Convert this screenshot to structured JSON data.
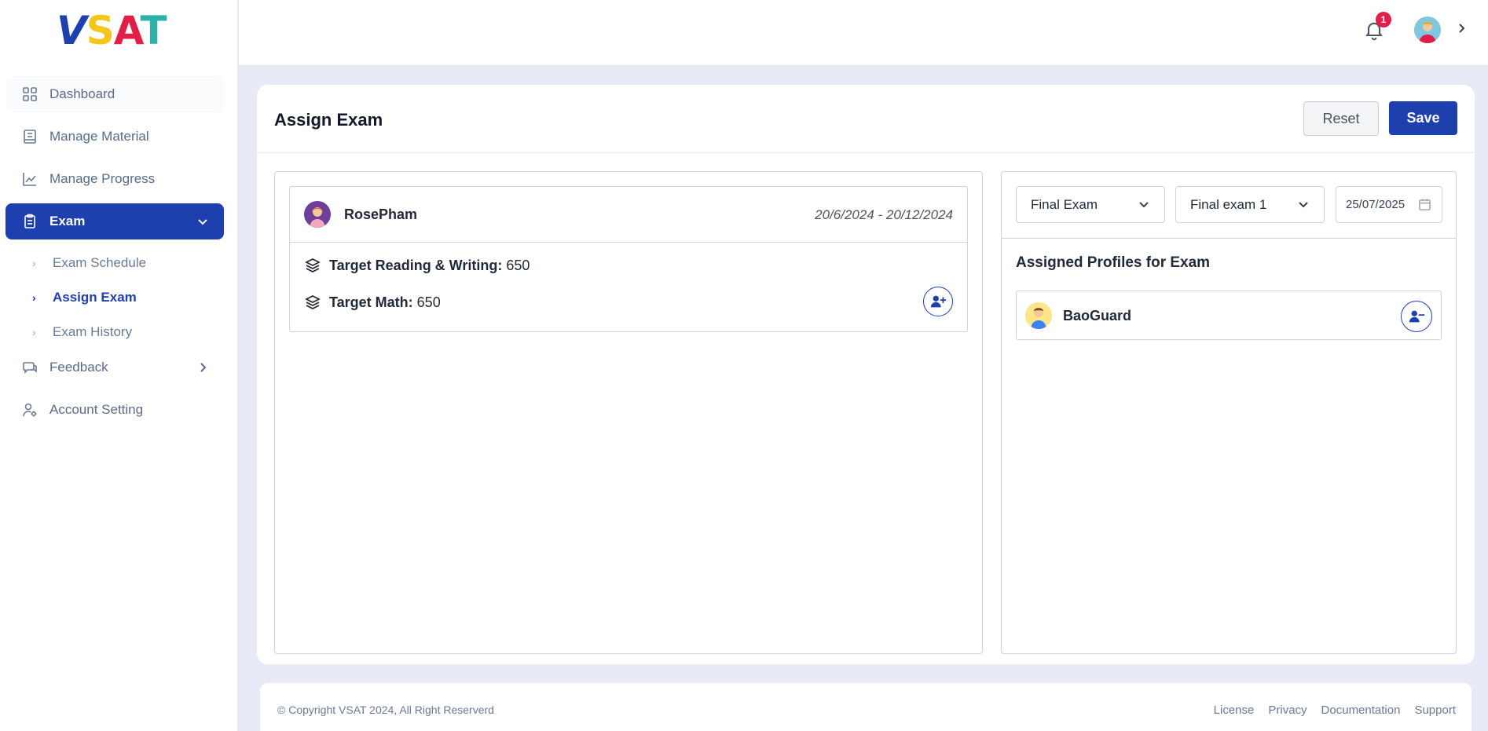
{
  "brand": {
    "letters": [
      "V",
      "S",
      "A",
      "T"
    ]
  },
  "sidebar": {
    "items": [
      {
        "label": "Dashboard",
        "icon": "grid-icon"
      },
      {
        "label": "Manage Material",
        "icon": "book-icon"
      },
      {
        "label": "Manage Progress",
        "icon": "chart-line-icon"
      },
      {
        "label": "Exam",
        "icon": "clipboard-icon",
        "active": true,
        "children": [
          {
            "label": "Exam Schedule"
          },
          {
            "label": "Assign Exam",
            "active": true
          },
          {
            "label": "Exam History"
          }
        ]
      },
      {
        "label": "Feedback",
        "icon": "chat-icon"
      },
      {
        "label": "Account Setting",
        "icon": "user-gear-icon"
      }
    ]
  },
  "topbar": {
    "notification_count": "1"
  },
  "page": {
    "title": "Assign Exam",
    "reset_label": "Reset",
    "save_label": "Save"
  },
  "student": {
    "name": "RosePham",
    "dates": "20/6/2024 - 20/12/2024",
    "targets": [
      {
        "label": "Target Reading & Writing:",
        "value": "650"
      },
      {
        "label": "Target Math:",
        "value": "650"
      }
    ]
  },
  "filters": {
    "exam_type": "Final Exam",
    "exam_name": "Final exam 1",
    "date": "25/07/2025"
  },
  "assigned": {
    "title": "Assigned Profiles for Exam",
    "profiles": [
      {
        "name": "BaoGuard"
      }
    ]
  },
  "footer": {
    "copyright": "© Copyright VSAT 2024, All Right Reserverd",
    "links": [
      "License",
      "Privacy",
      "Documentation",
      "Support"
    ]
  },
  "colors": {
    "primary": "#1e3fae",
    "badge": "#e11d48",
    "background": "#e8ebf7"
  }
}
